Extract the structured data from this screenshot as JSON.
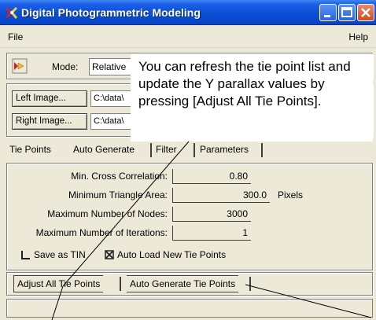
{
  "window": {
    "title": "Digital Photogrammetric Modeling"
  },
  "menu": {
    "file": "File",
    "help": "Help"
  },
  "mode": {
    "label": "Mode:",
    "value": "Relative"
  },
  "images": {
    "left_button": "Left Image...",
    "left_path": "C:\\data\\",
    "right_button": "Right Image...",
    "right_path": "C:\\data\\"
  },
  "tabs": [
    "Tie Points",
    "Auto Generate",
    "Filter",
    "Parameters"
  ],
  "parameters": {
    "min_cross_correlation": {
      "label": "Min. Cross Correlation:",
      "value": "0.80"
    },
    "min_triangle_area": {
      "label": "Minimum Triangle Area:",
      "value": "300.0",
      "unit": "Pixels"
    },
    "max_nodes": {
      "label": "Maximum Number of Nodes:",
      "value": "3000"
    },
    "max_iterations": {
      "label": "Maximum Number of Iterations:",
      "value": "1"
    }
  },
  "options": {
    "save_as_tin": {
      "label": "Save as TIN",
      "checked": false
    },
    "auto_load": {
      "label": "Auto Load New Tie Points",
      "checked": true
    }
  },
  "actions": {
    "adjust_all": "Adjust All Tie Points",
    "auto_generate": "Auto Generate Tie Points"
  },
  "status": "",
  "callout": {
    "text": "You can refresh the tie point list and update the Y parallax values by pressing [Adjust All Tie Points]."
  },
  "colors": {
    "title_bar": "#0a4fd6",
    "window_bg": "#ece9d8",
    "close_button": "#d24a22"
  }
}
